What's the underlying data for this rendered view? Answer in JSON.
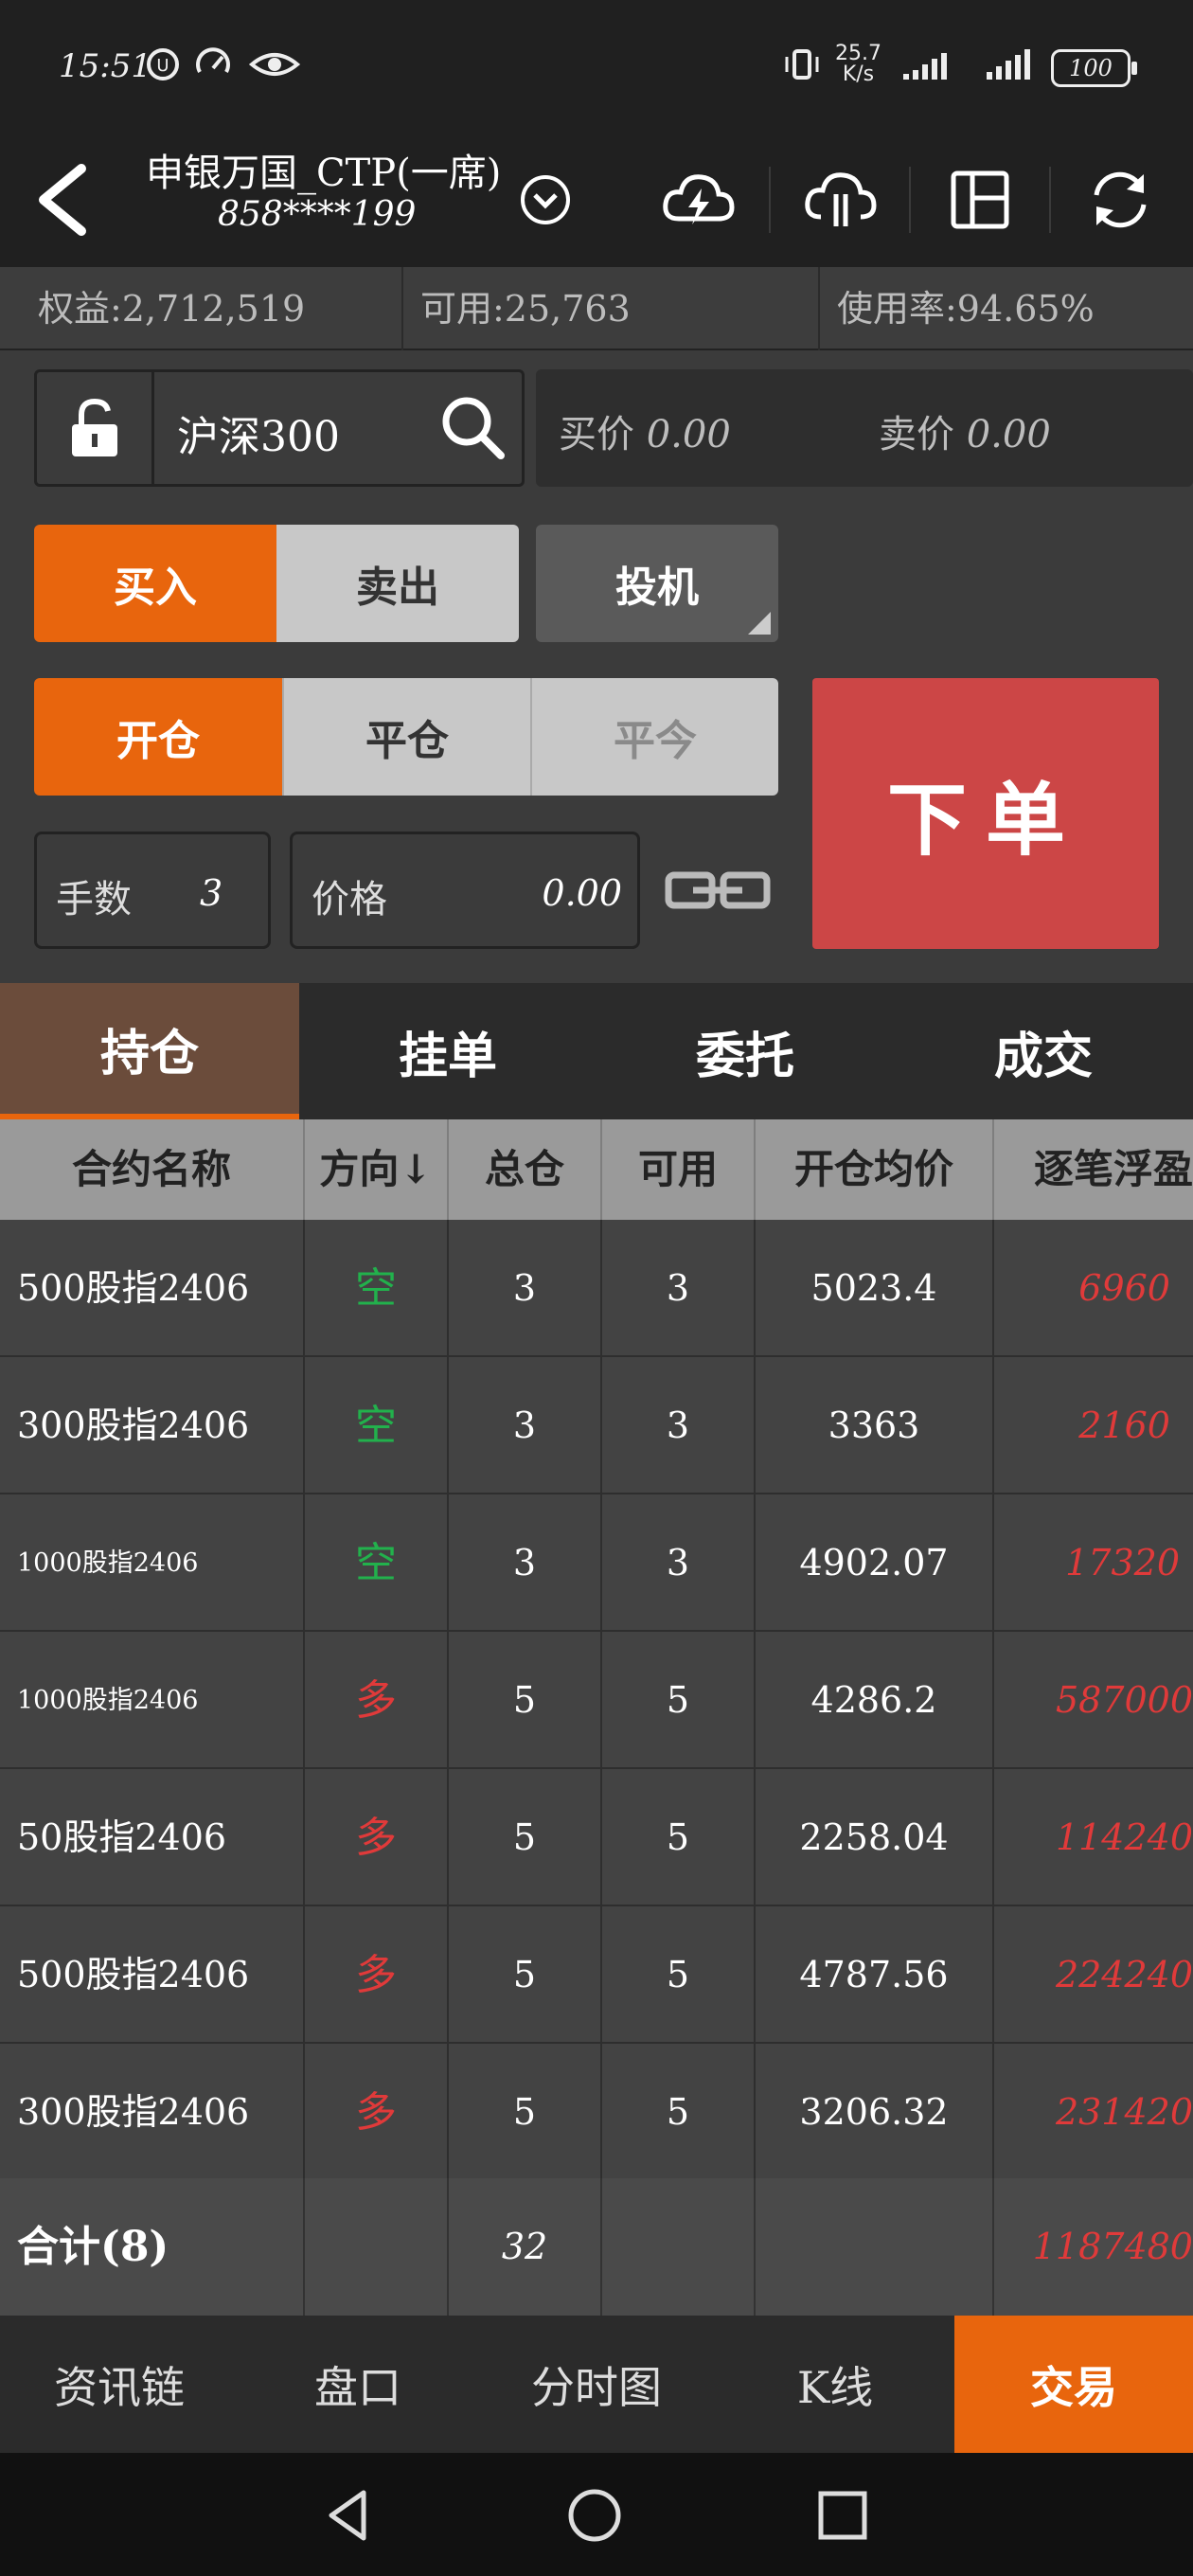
{
  "status": {
    "time": "15:51",
    "speed_top": "25.7",
    "speed_unit": "K/s",
    "battery": "100"
  },
  "header": {
    "account_name": "申银万国_CTP(一席)",
    "account_number": "858****199"
  },
  "account_bar": {
    "equity": "权益:2,712,519",
    "available": "可用:25,763",
    "usage": "使用率:94.65%"
  },
  "order": {
    "symbol": "沪深300",
    "bid_label": "买价",
    "bid_value": "0.00",
    "ask_label": "卖价",
    "ask_value": "0.00",
    "buy": "买入",
    "sell": "卖出",
    "speculation": "投机",
    "open": "开仓",
    "close": "平仓",
    "close_today": "平今",
    "lots_label": "手数",
    "lots_value": "3",
    "price_label": "价格",
    "price_value": "0.00",
    "submit": "下单"
  },
  "tabs": [
    "持仓",
    "挂单",
    "委托",
    "成交"
  ],
  "table": {
    "headers": [
      "合约名称",
      "方向↓",
      "总仓",
      "可用",
      "开仓均价",
      "逐笔浮盈"
    ],
    "rows": [
      {
        "name": "500股指2406",
        "dir": "空",
        "total": "3",
        "avail": "3",
        "avg": "5023.4",
        "pnl": "6960"
      },
      {
        "name": "300股指2406",
        "dir": "空",
        "total": "3",
        "avail": "3",
        "avg": "3363",
        "pnl": "2160"
      },
      {
        "name": "1000股指2406",
        "dir": "空",
        "total": "3",
        "avail": "3",
        "avg": "4902.07",
        "pnl": "17320"
      },
      {
        "name": "1000股指2406",
        "dir": "多",
        "total": "5",
        "avail": "5",
        "avg": "4286.2",
        "pnl": "587000"
      },
      {
        "name": "50股指2406",
        "dir": "多",
        "total": "5",
        "avail": "5",
        "avg": "2258.04",
        "pnl": "114240"
      },
      {
        "name": "500股指2406",
        "dir": "多",
        "total": "5",
        "avail": "5",
        "avg": "4787.56",
        "pnl": "224240"
      },
      {
        "name": "300股指2406",
        "dir": "多",
        "total": "5",
        "avail": "5",
        "avg": "3206.32",
        "pnl": "231420"
      }
    ],
    "total": {
      "label": "合计(8)",
      "total": "32",
      "pnl": "1187480"
    }
  },
  "bottom_nav": [
    "资讯链",
    "盘口",
    "分时图",
    "K线",
    "交易"
  ],
  "colors": {
    "accent": "#e8650d",
    "order_button": "#cc4646",
    "short": "#22b14c",
    "long": "#e03a3a"
  }
}
